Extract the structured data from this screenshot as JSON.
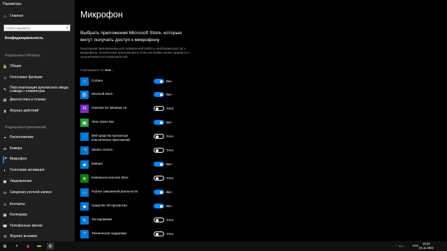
{
  "app": {
    "title": "Параметры"
  },
  "sidebar": {
    "home": "Главная",
    "search_placeholder": "Найти параметр",
    "category": "Конфиденциальность",
    "section_windows": "Разрешения Windows",
    "windows_items": [
      {
        "label": "Общие",
        "icon": "lock-icon"
      },
      {
        "label": "Голосовые функции",
        "icon": "speech-icon"
      },
      {
        "label": "Персонализация рукописного ввода и ввода с клавиатуры",
        "icon": "pen-icon"
      },
      {
        "label": "Диагностика и отзывы",
        "icon": "feedback-icon"
      },
      {
        "label": "Журнал действий",
        "icon": "history-icon"
      }
    ],
    "section_apps": "Разрешения приложений",
    "app_items": [
      {
        "label": "Расположение",
        "icon": "location-icon"
      },
      {
        "label": "Камера",
        "icon": "camera-icon"
      },
      {
        "label": "Микрофон",
        "icon": "microphone-icon"
      },
      {
        "label": "Голосовая активация",
        "icon": "voice-activation-icon"
      },
      {
        "label": "Уведомления",
        "icon": "notification-icon"
      },
      {
        "label": "Сведения учетной записи",
        "icon": "account-icon"
      },
      {
        "label": "Контакты",
        "icon": "contacts-icon"
      },
      {
        "label": "Календарь",
        "icon": "calendar-icon"
      },
      {
        "label": "Телефонные звонки",
        "icon": "phone-icon"
      },
      {
        "label": "Журнал вызовов",
        "icon": "call-history-icon"
      }
    ]
  },
  "main": {
    "title": "Микрофон",
    "heading": "Выбрать приложения Microsoft Store, которые могут получать доступ к микрофону",
    "description": "Некоторым приложениям для правильной работы необходим доступ к микрофону. Отключение приложения в этом настройке может привести к ограничению его возможностей.",
    "sort_label": "Сортировать по",
    "sort_value": "Имя",
    "apps": [
      {
        "name": "Cortana",
        "state": "Вкл.",
        "on": true,
        "icon_color": "#0078d7",
        "glyph": "○"
      },
      {
        "name": "Microsoft Store",
        "state": "Вкл.",
        "on": true,
        "icon_color": "#0078d7",
        "glyph": "🛍"
      },
      {
        "name": "OneNote for Windows 10",
        "state": "Откл.",
        "on": false,
        "icon_color": "#7b2fbe",
        "glyph": "N"
      },
      {
        "name": "Xbox Game Bar",
        "state": "Вкл.",
        "on": true,
        "icon_color": "#2a9d3a",
        "glyph": "▣"
      },
      {
        "name": "Веб-средство просмотра классических приложений",
        "state": "Откл.",
        "on": false,
        "icon_color": "#0078d7",
        "glyph": ""
      },
      {
        "name": "Запись голоса",
        "state": "Откл.",
        "on": false,
        "icon_color": "#0078d7",
        "glyph": "🎤"
      },
      {
        "name": "Камера",
        "state": "Вкл.",
        "on": true,
        "icon_color": "#0078d7",
        "glyph": "◉"
      },
      {
        "name": "Компаньон консоли Xbox",
        "state": "Откл.",
        "on": false,
        "icon_color": "#107c10",
        "glyph": "⊗"
      },
      {
        "name": "Портал смешанной реальности",
        "state": "Вкл.",
        "on": true,
        "icon_color": "#0078d7",
        "glyph": "▭"
      },
      {
        "name": "Средство 3D-просмотра",
        "state": "Вкл.",
        "on": true,
        "icon_color": "#0078d7",
        "glyph": "◆"
      },
      {
        "name": "Тестирование",
        "state": "Откл.",
        "on": false,
        "icon_color": "#0078d7",
        "glyph": "✎"
      },
      {
        "name": "Техническая поддержка",
        "state": "Откл.",
        "on": false,
        "icon_color": "#0078d7",
        "glyph": "?"
      }
    ]
  },
  "taskbar": {
    "lang": "РУС",
    "time": "18:24",
    "date": "01.11.2022"
  }
}
